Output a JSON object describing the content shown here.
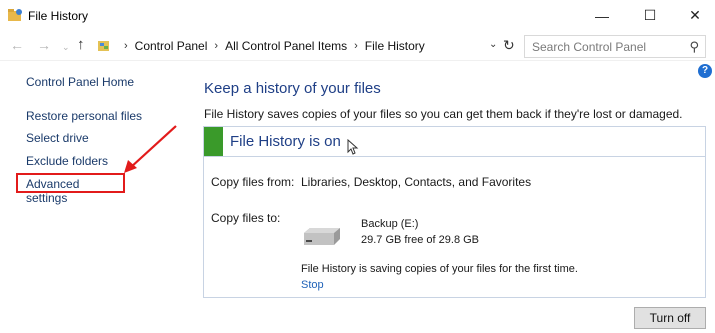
{
  "window": {
    "title": "File History",
    "minimize_glyph": "—",
    "maximize_glyph": "☐",
    "close_glyph": "✕"
  },
  "nav": {
    "back_glyph": "←",
    "forward_glyph": "→",
    "recent_glyph": "⌄",
    "up_glyph": "↑",
    "breadcrumb": [
      "Control Panel",
      "All Control Panel Items",
      "File History"
    ],
    "separator": "›",
    "dropdown_glyph": "⌄",
    "refresh_glyph": "↻",
    "search_placeholder": "Search Control Panel",
    "search_glyph": "⚲"
  },
  "sidebar": {
    "items": [
      {
        "label": "Control Panel Home"
      },
      {
        "label": "Restore personal files"
      },
      {
        "label": "Select drive"
      },
      {
        "label": "Exclude folders"
      },
      {
        "label": "Advanced settings",
        "highlighted": true
      }
    ]
  },
  "main": {
    "heading": "Keep a history of your files",
    "description": "File History saves copies of your files so you can get them back if they're lost or damaged.",
    "help_glyph": "?",
    "status": "File History is on",
    "copy_from_label": "Copy files from:",
    "copy_from_value": "Libraries, Desktop, Contacts, and Favorites",
    "copy_to_label": "Copy files to:",
    "drive_name": "Backup (E:)",
    "drive_free": "29.7 GB free of 29.8 GB",
    "saving_message": "File History is saving copies of your files for the first time.",
    "stop_link": "Stop",
    "turn_off_button": "Turn off"
  },
  "colors": {
    "accent_blue": "#1f3f86",
    "link_blue": "#1f62b8",
    "status_green": "#3a9a2a",
    "highlight_red": "#e21b1b"
  }
}
